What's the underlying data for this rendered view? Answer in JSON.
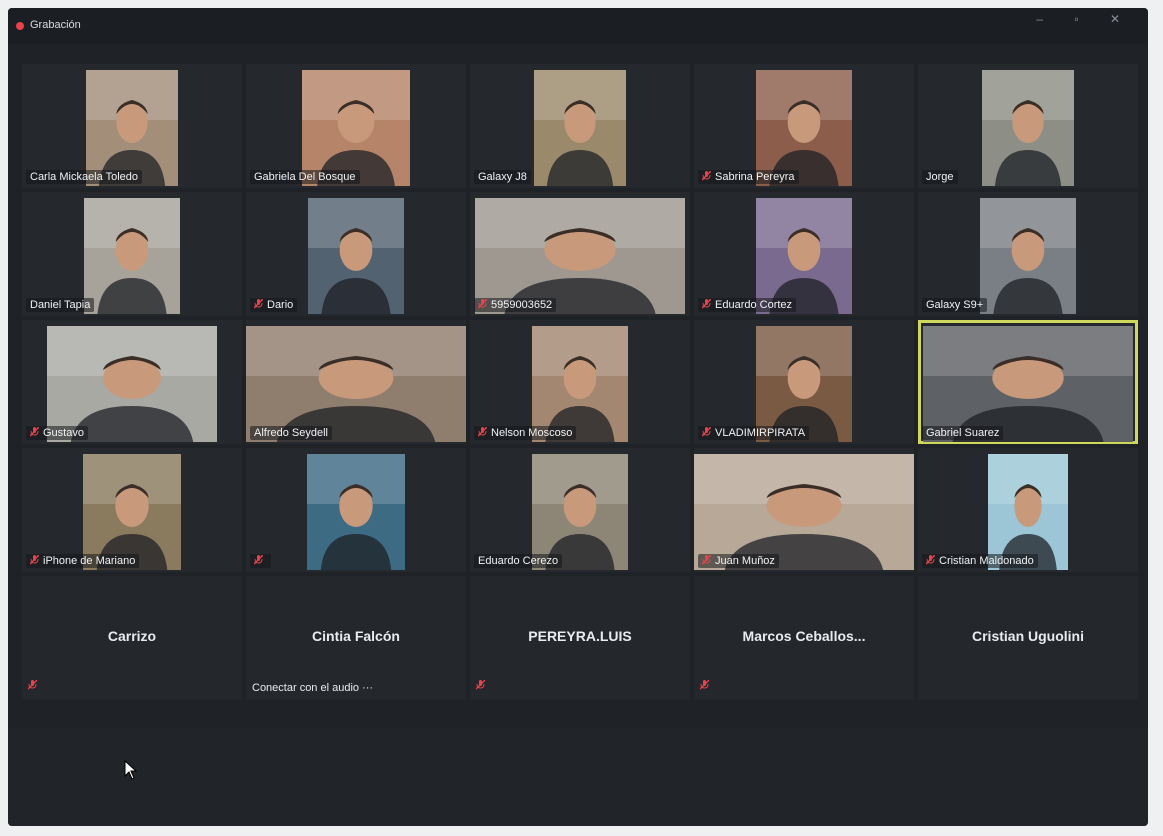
{
  "recording": {
    "label": "Grabación",
    "status_color": "#e8434a"
  },
  "window_controls": "– ▫ ✕",
  "participants": [
    {
      "name": "Carla Mickaela Toledo",
      "muted": false,
      "tone": "#a38e7a"
    },
    {
      "name": "Gabriela Del Bosque",
      "muted": false,
      "tone": "#b58469"
    },
    {
      "name": "Galaxy J8",
      "muted": false,
      "tone": "#9a8a6b"
    },
    {
      "name": "Sabrina Pereyra",
      "muted": true,
      "tone": "#8b5d4a"
    },
    {
      "name": "Jorge",
      "muted": false,
      "tone": "#8d8f86"
    },
    {
      "name": "Daniel Tapia",
      "muted": false,
      "tone": "#a7a29a"
    },
    {
      "name": "Dario",
      "muted": true,
      "tone": "#536270"
    },
    {
      "name": "5959003652",
      "muted": true,
      "tone": "#9e9890"
    },
    {
      "name": "Eduardo Cortez",
      "muted": true,
      "tone": "#7b6a8f"
    },
    {
      "name": "Galaxy S9+",
      "muted": false,
      "tone": "#7a7f85"
    },
    {
      "name": "Gustavo",
      "muted": true,
      "tone": "#a9a9a4"
    },
    {
      "name": "Alfredo Seydell",
      "muted": false,
      "tone": "#8f7d6d"
    },
    {
      "name": "Nelson Moscoso",
      "muted": true,
      "tone": "#a38770"
    },
    {
      "name": "VLADIMIRPIRATA",
      "muted": true,
      "tone": "#7a5a42"
    },
    {
      "name": "Gabriel Suarez",
      "muted": false,
      "tone": "#5e6166",
      "active": true
    },
    {
      "name": "iPhone de Mariano",
      "muted": true,
      "tone": "#8a7a5e"
    },
    {
      "name": "",
      "muted": true,
      "tone": "#3e6b84"
    },
    {
      "name": "Eduardo Cerezo",
      "muted": false,
      "tone": "#8d8576"
    },
    {
      "name": "Juan Muñoz",
      "muted": true,
      "tone": "#b7a898"
    },
    {
      "name": "Cristian Maldonado",
      "muted": true,
      "tone": "#9cc6d6"
    }
  ],
  "audio_only": [
    {
      "name": "Carrizo",
      "muted": true,
      "sub": ""
    },
    {
      "name": "Cintia Falcón",
      "muted": false,
      "sub": "Conectar con el audio ···"
    },
    {
      "name": "PEREYRA.LUIS",
      "muted": true,
      "sub": ""
    },
    {
      "name": "Marcos  Ceballos...",
      "muted": true,
      "sub": ""
    },
    {
      "name": "Cristian Uguolini",
      "muted": false,
      "sub": ""
    }
  ]
}
